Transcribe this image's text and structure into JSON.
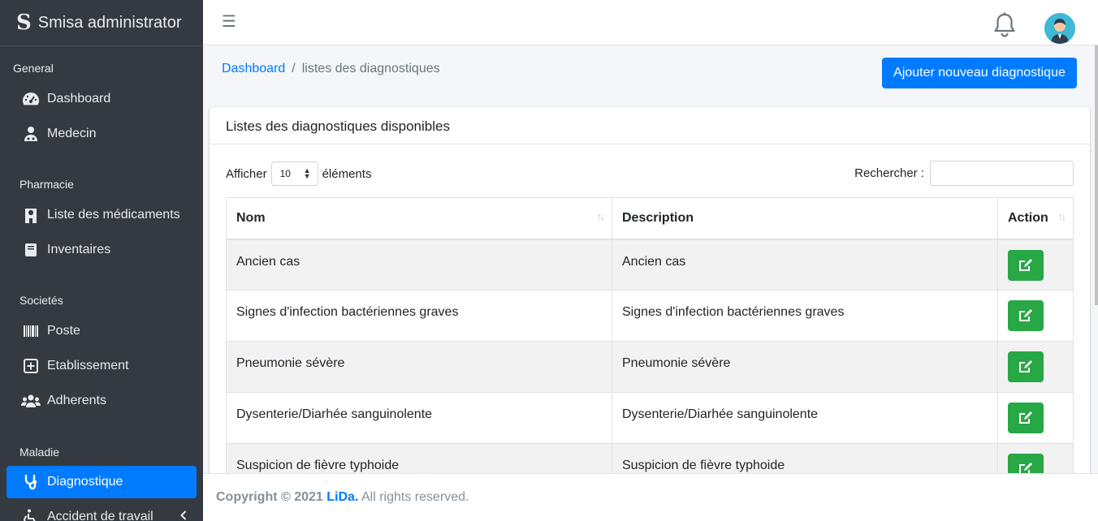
{
  "brand": {
    "logo": "S",
    "name": "Smisa administrator"
  },
  "sidebar": {
    "sections": [
      {
        "header": "General",
        "items": [
          {
            "label": "Dashboard",
            "icon": "tachometer-icon"
          },
          {
            "label": "Medecin",
            "icon": "user-md-icon"
          }
        ]
      },
      {
        "header": "Pharmacie",
        "items": [
          {
            "label": "Liste des médicaments",
            "icon": "hospital-icon"
          },
          {
            "label": "Inventaires",
            "icon": "book-icon"
          }
        ]
      },
      {
        "header": "Societés",
        "items": [
          {
            "label": "Poste",
            "icon": "barcode-icon"
          },
          {
            "label": "Etablissement",
            "icon": "plus-square-icon"
          },
          {
            "label": "Adherents",
            "icon": "users-icon"
          }
        ]
      },
      {
        "header": "Maladie",
        "items": [
          {
            "label": "Diagnostique",
            "icon": "stethoscope-icon",
            "active": true
          },
          {
            "label": "Accident de travail",
            "icon": "wheelchair-icon"
          }
        ]
      }
    ]
  },
  "topnav": {
    "menu_icon": "☰"
  },
  "breadcrumb": {
    "home": "Dashboard",
    "separator": "/",
    "current": "listes des diagnostiques"
  },
  "actions": {
    "add_label": "Ajouter nouveau diagnostique"
  },
  "card": {
    "title": "Listes des diagnostiques disponibles",
    "length_prefix": "Afficher",
    "length_value": "10",
    "length_suffix": "éléments",
    "search_label": "Rechercher :"
  },
  "table": {
    "columns": [
      "Nom",
      "Description",
      "Action"
    ],
    "sort_glyph": "↑↓",
    "rows": [
      {
        "nom": "Ancien cas",
        "description": "Ancien cas"
      },
      {
        "nom": "Signes d'infection bactériennes graves",
        "description": "Signes d'infection bactériennes graves"
      },
      {
        "nom": "Pneumonie sévère",
        "description": "Pneumonie sévère"
      },
      {
        "nom": "Dysenterie/Diarhée sanguinolente",
        "description": "Dysenterie/Diarhée sanguinolente"
      },
      {
        "nom": "Suspicion de fièvre typhoide",
        "description": "Suspicion de fièvre typhoide"
      }
    ]
  },
  "footer": {
    "copyright": "Copyright © 2021",
    "brand": "LiDa.",
    "rights": "All rights reserved."
  },
  "colors": {
    "primary": "#007bff",
    "success": "#28a745",
    "sidebar": "#343a40"
  }
}
